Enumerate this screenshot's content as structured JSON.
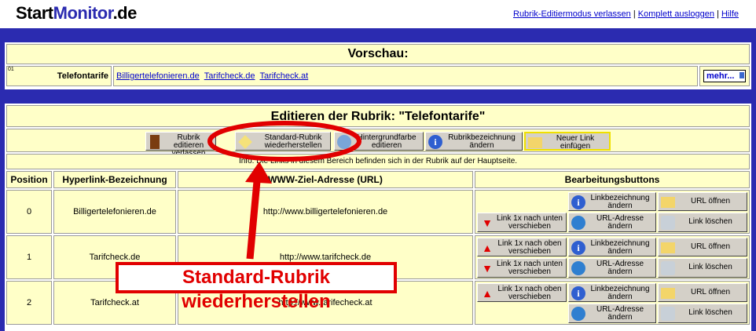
{
  "logo": {
    "part1": "Start",
    "part2": "Monitor",
    "part3": ".de"
  },
  "toplinks": [
    "Rubrik-Editiermodus verlassen",
    "Komplett ausloggen",
    "Hilfe"
  ],
  "toplinks_sep": "|",
  "preview": {
    "title": "Vorschau:",
    "number": "01",
    "category": "Telefontarife",
    "links": [
      "Billigertelefonieren.de",
      "Tarifcheck.de",
      "Tarifcheck.at"
    ],
    "more": "mehr..."
  },
  "editor": {
    "title": "Editieren der Rubrik: \"Telefontarife\"",
    "buttons": [
      {
        "label": "Rubrik editieren verlassen",
        "icon": "door-icon"
      },
      {
        "label": "Standard-Rubrik wiederherstellen",
        "icon": "restore-icon"
      },
      {
        "label": "Hintergrundfarbe editieren",
        "icon": "palette-icon"
      },
      {
        "label": "Rubrikbezeichnung ändern",
        "icon": "info-icon"
      },
      {
        "label": "Neuer Link einfügen",
        "icon": "folder-icon"
      }
    ],
    "info": "Info: Die Links in diesem Bereich befinden sich in der Rubrik auf der Hauptseite.",
    "columns": [
      "Position",
      "Hyperlink-Bezeichnung",
      "WWW-Ziel-Adresse (URL)",
      "Bearbeitungsbuttons"
    ],
    "rows": [
      {
        "position": "0",
        "name": "Billigertelefonieren.de",
        "url": "http://www.billigertelefonieren.de"
      },
      {
        "position": "1",
        "name": "Tarifcheck.de",
        "url": "http://www.tarifcheck.de"
      },
      {
        "position": "2",
        "name": "Tarifcheck.at",
        "url": "http://www.tarifecheck.at"
      }
    ],
    "row_buttons": {
      "up": "Link 1x nach oben verschieben",
      "down": "Link 1x nach unten verschieben",
      "rename": "Linkbezeichnung ändern",
      "url": "URL-Adresse ändern",
      "open": "URL öffnen",
      "delete": "Link löschen"
    }
  },
  "annotation": "Standard-Rubrik wiederherstellen",
  "colors": {
    "background": "#2b2bb0",
    "cell": "#ffffc8",
    "annotation": "#e10000",
    "link": "#0000cc"
  }
}
